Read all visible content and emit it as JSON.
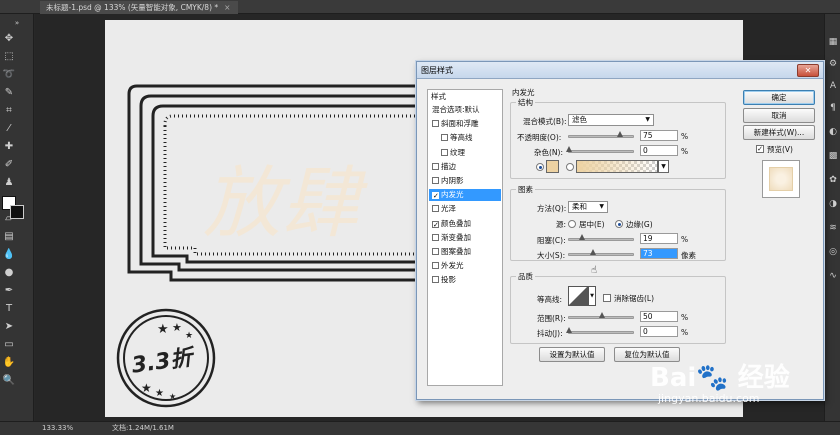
{
  "doc_tab": {
    "title": "未标题-1.psd @ 133% (矢量智能对象, CMYK/8) *",
    "close": "×"
  },
  "toolbar": {
    "collapse": "»"
  },
  "canvas": {
    "artwork_text": "放肆",
    "badge_text": "3.3折"
  },
  "status": {
    "zoom": "133.33%",
    "doc_info": "文档:1.24M/1.61M"
  },
  "dialog": {
    "title": "图层样式",
    "close": "✕",
    "styles": {
      "header": "样式",
      "items": [
        {
          "label": "混合选项:默认",
          "checkbox": false,
          "checked": false,
          "sub": false,
          "selected": false
        },
        {
          "label": "斜面和浮雕",
          "checkbox": true,
          "checked": false,
          "sub": false,
          "selected": false
        },
        {
          "label": "等高线",
          "checkbox": true,
          "checked": false,
          "sub": true,
          "selected": false
        },
        {
          "label": "纹理",
          "checkbox": true,
          "checked": false,
          "sub": true,
          "selected": false
        },
        {
          "label": "描边",
          "checkbox": true,
          "checked": false,
          "sub": false,
          "selected": false
        },
        {
          "label": "内阴影",
          "checkbox": true,
          "checked": false,
          "sub": false,
          "selected": false
        },
        {
          "label": "内发光",
          "checkbox": true,
          "checked": true,
          "sub": false,
          "selected": true
        },
        {
          "label": "光泽",
          "checkbox": true,
          "checked": false,
          "sub": false,
          "selected": false
        },
        {
          "label": "颜色叠加",
          "checkbox": true,
          "checked": true,
          "sub": false,
          "selected": false
        },
        {
          "label": "渐变叠加",
          "checkbox": true,
          "checked": false,
          "sub": false,
          "selected": false
        },
        {
          "label": "图案叠加",
          "checkbox": true,
          "checked": false,
          "sub": false,
          "selected": false
        },
        {
          "label": "外发光",
          "checkbox": true,
          "checked": false,
          "sub": false,
          "selected": false
        },
        {
          "label": "投影",
          "checkbox": true,
          "checked": false,
          "sub": false,
          "selected": false
        }
      ]
    },
    "panel_title": "内发光",
    "structure": {
      "title": "结构",
      "blend_mode_label": "混合模式(B):",
      "blend_mode_value": "滤色",
      "opacity_label": "不透明度(O):",
      "opacity_value": "75",
      "noise_label": "杂色(N):",
      "noise_value": "0",
      "percent": "%",
      "glow_color": "#edd2a2"
    },
    "elements": {
      "title": "图素",
      "technique_label": "方法(Q):",
      "technique_value": "柔和",
      "source_label": "源:",
      "source_center": "居中(E)",
      "source_edge": "边缘(G)",
      "choke_label": "阻塞(C):",
      "choke_value": "19",
      "size_label": "大小(S):",
      "size_value": "73",
      "percent": "%",
      "px": "像素"
    },
    "quality": {
      "title": "品质",
      "contour_label": "等高线:",
      "antialias_label": "消除锯齿(L)",
      "range_label": "范围(R):",
      "range_value": "50",
      "jitter_label": "抖动(J):",
      "jitter_value": "0",
      "percent": "%"
    },
    "buttons": {
      "make_default": "设置为默认值",
      "reset_default": "复位为默认值",
      "ok": "确定",
      "cancel": "取消",
      "new_style": "新建样式(W)...",
      "preview": "预览(V)"
    }
  },
  "watermark": {
    "logo": "Bai🐾 经验",
    "url": "jingyan.baidu.com"
  }
}
